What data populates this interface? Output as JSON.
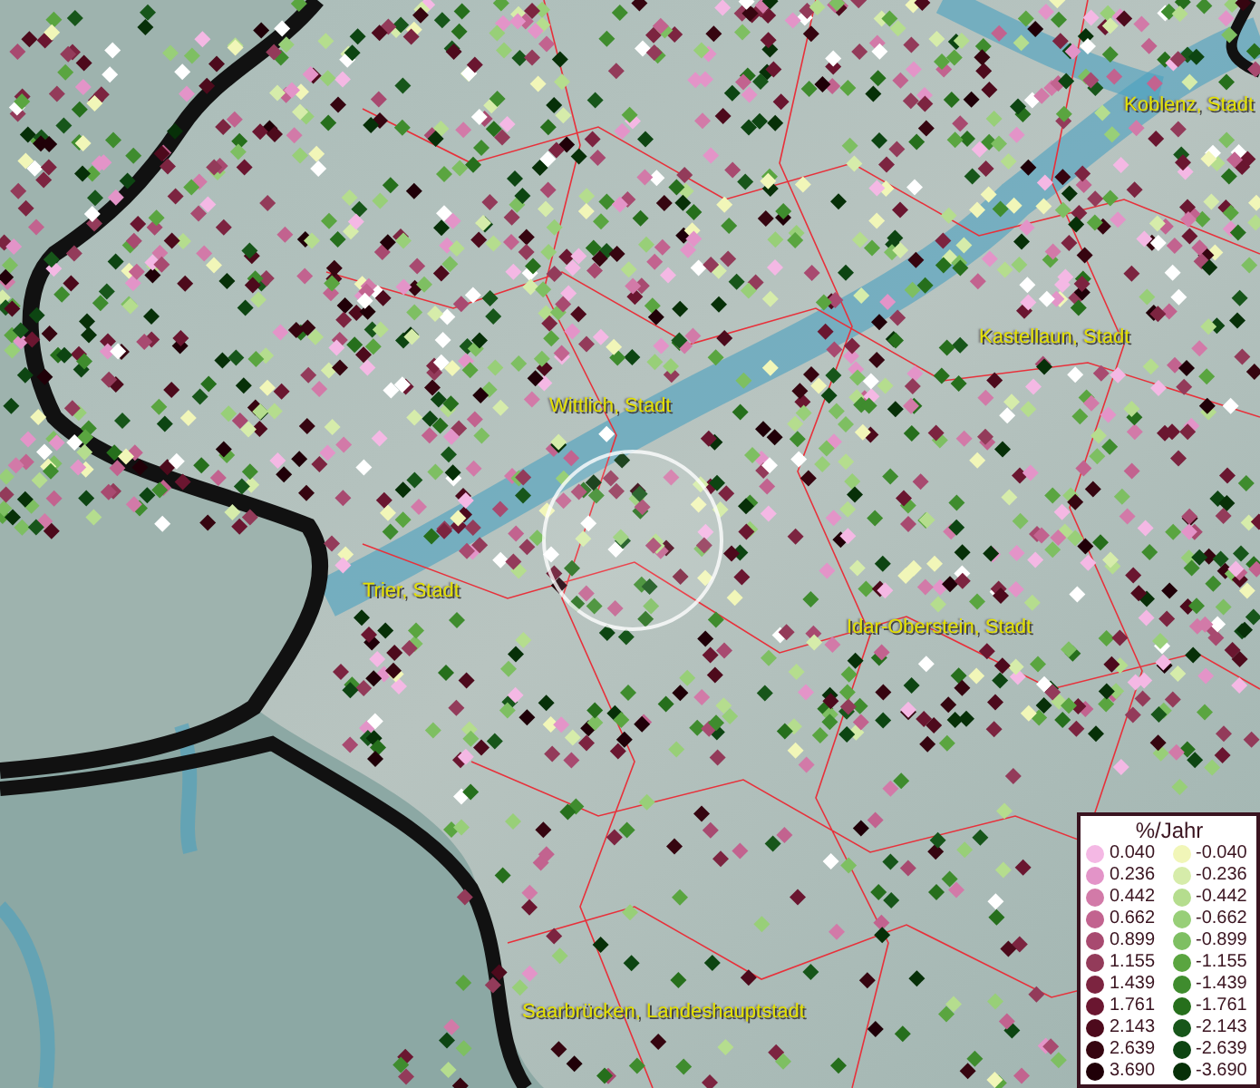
{
  "map": {
    "labels": [
      {
        "text": "Koblenz, Stadt"
      },
      {
        "text": "Kastellaun, Stadt"
      },
      {
        "text": "Wittlich, Stadt"
      },
      {
        "text": "Trier, Stadt"
      },
      {
        "text": "Idar-Oberstein, Stadt"
      },
      {
        "text": "Saarbrücken, Landeshauptstadt"
      }
    ]
  },
  "legend": {
    "title": "%/Jahr",
    "rows": [
      {
        "positive": {
          "value": "0.040",
          "color": "#f4b8e4"
        },
        "negative": {
          "value": "-0.040",
          "color": "#f1f6b8"
        }
      },
      {
        "positive": {
          "value": "0.236",
          "color": "#e394c8"
        },
        "negative": {
          "value": "-0.236",
          "color": "#d6ecaa"
        }
      },
      {
        "positive": {
          "value": "0.442",
          "color": "#d27aa8"
        },
        "negative": {
          "value": "-0.442",
          "color": "#b5dd8e"
        }
      },
      {
        "positive": {
          "value": "0.662",
          "color": "#c2638f"
        },
        "negative": {
          "value": "-0.662",
          "color": "#98cf78"
        }
      },
      {
        "positive": {
          "value": "0.899",
          "color": "#a84a70"
        },
        "negative": {
          "value": "-0.899",
          "color": "#7ebf62"
        }
      },
      {
        "positive": {
          "value": "1.155",
          "color": "#933b5a"
        },
        "negative": {
          "value": "-1.155",
          "color": "#5aa540"
        }
      },
      {
        "positive": {
          "value": "1.439",
          "color": "#7c2440"
        },
        "negative": {
          "value": "-1.439",
          "color": "#3f8c2e"
        }
      },
      {
        "positive": {
          "value": "1.761",
          "color": "#6a1630"
        },
        "negative": {
          "value": "-1.761",
          "color": "#266f1c"
        }
      },
      {
        "positive": {
          "value": "2.143",
          "color": "#4d0a1c"
        },
        "negative": {
          "value": "-2.143",
          "color": "#17561a"
        }
      },
      {
        "positive": {
          "value": "2.639",
          "color": "#360510"
        },
        "negative": {
          "value": "-2.639",
          "color": "#0d4512"
        }
      },
      {
        "positive": {
          "value": "3.690",
          "color": "#200008"
        },
        "negative": {
          "value": "-3.690",
          "color": "#073008"
        }
      }
    ]
  }
}
